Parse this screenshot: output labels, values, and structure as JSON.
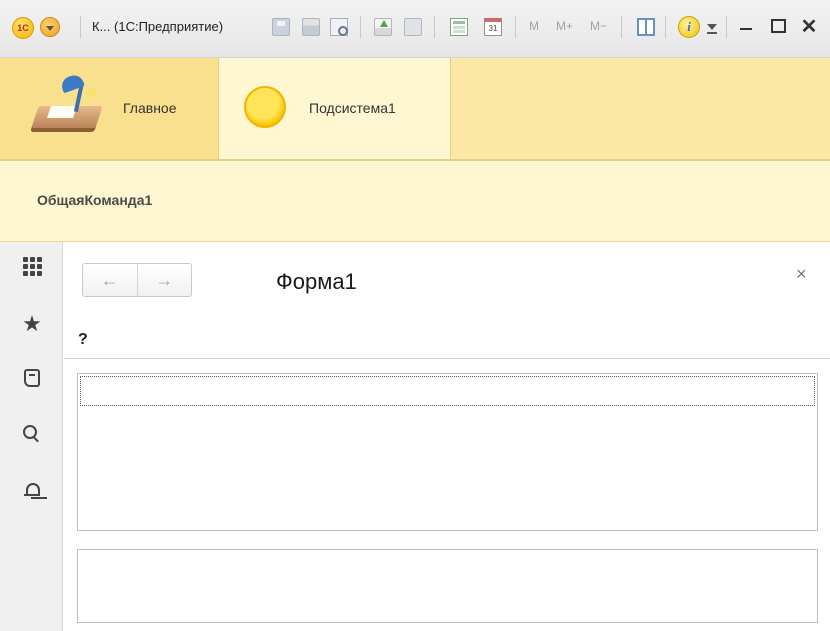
{
  "titlebar": {
    "logo_text": "1С",
    "window_title": "К... (1С:Предприятие)",
    "memory_buttons": [
      "M",
      "M+",
      "M−"
    ],
    "calendar_day": "31",
    "info_symbol": "i",
    "close_symbol": "✕"
  },
  "sections": [
    {
      "label": "Главное",
      "icon": "desk-lamp-icon"
    },
    {
      "label": "Подсистема1",
      "icon": "sun-icon",
      "selected": true
    }
  ],
  "commands": {
    "items": [
      "ОбщаяКоманда1"
    ]
  },
  "toolpanel": {
    "icons": [
      "apps-grid-icon",
      "favorites-star-icon",
      "history-icon",
      "search-icon",
      "notifications-bell-icon"
    ],
    "star_glyph": "★"
  },
  "form": {
    "title": "Форма1",
    "back_symbol": "←",
    "forward_symbol": "→",
    "close_symbol": "×",
    "question_label": "?"
  },
  "colors": {
    "sections_bg": "#fbe8a4",
    "section_active_bg": "#f8e08e",
    "commands_bg": "#fff6d2",
    "toolpanel_bg": "#f0f0f0"
  }
}
